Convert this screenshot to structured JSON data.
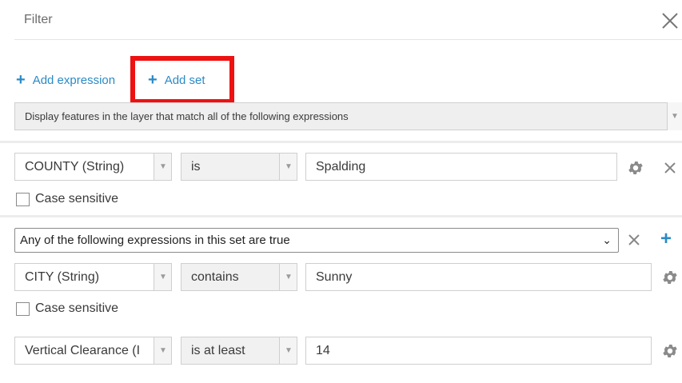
{
  "header": {
    "title": "Filter"
  },
  "actions": {
    "add_expression": "Add expression",
    "add_set": "Add set"
  },
  "display_mode": {
    "selected": "Display features in the layer that match all of the following expressions"
  },
  "expression_1": {
    "field": "COUNTY (String)",
    "operator": "is",
    "value": "Spalding",
    "case_sensitive_label": "Case sensitive"
  },
  "set": {
    "mode": "Any of the following expressions in this set are true",
    "expressions": [
      {
        "field": "CITY (String)",
        "operator": "contains",
        "value": "Sunny",
        "case_sensitive_label": "Case sensitive"
      },
      {
        "field": "Vertical Clearance (I",
        "operator": "is at least",
        "value": "14"
      }
    ]
  },
  "colors": {
    "accent": "#2b8ac6",
    "highlight": "#ee1111"
  }
}
